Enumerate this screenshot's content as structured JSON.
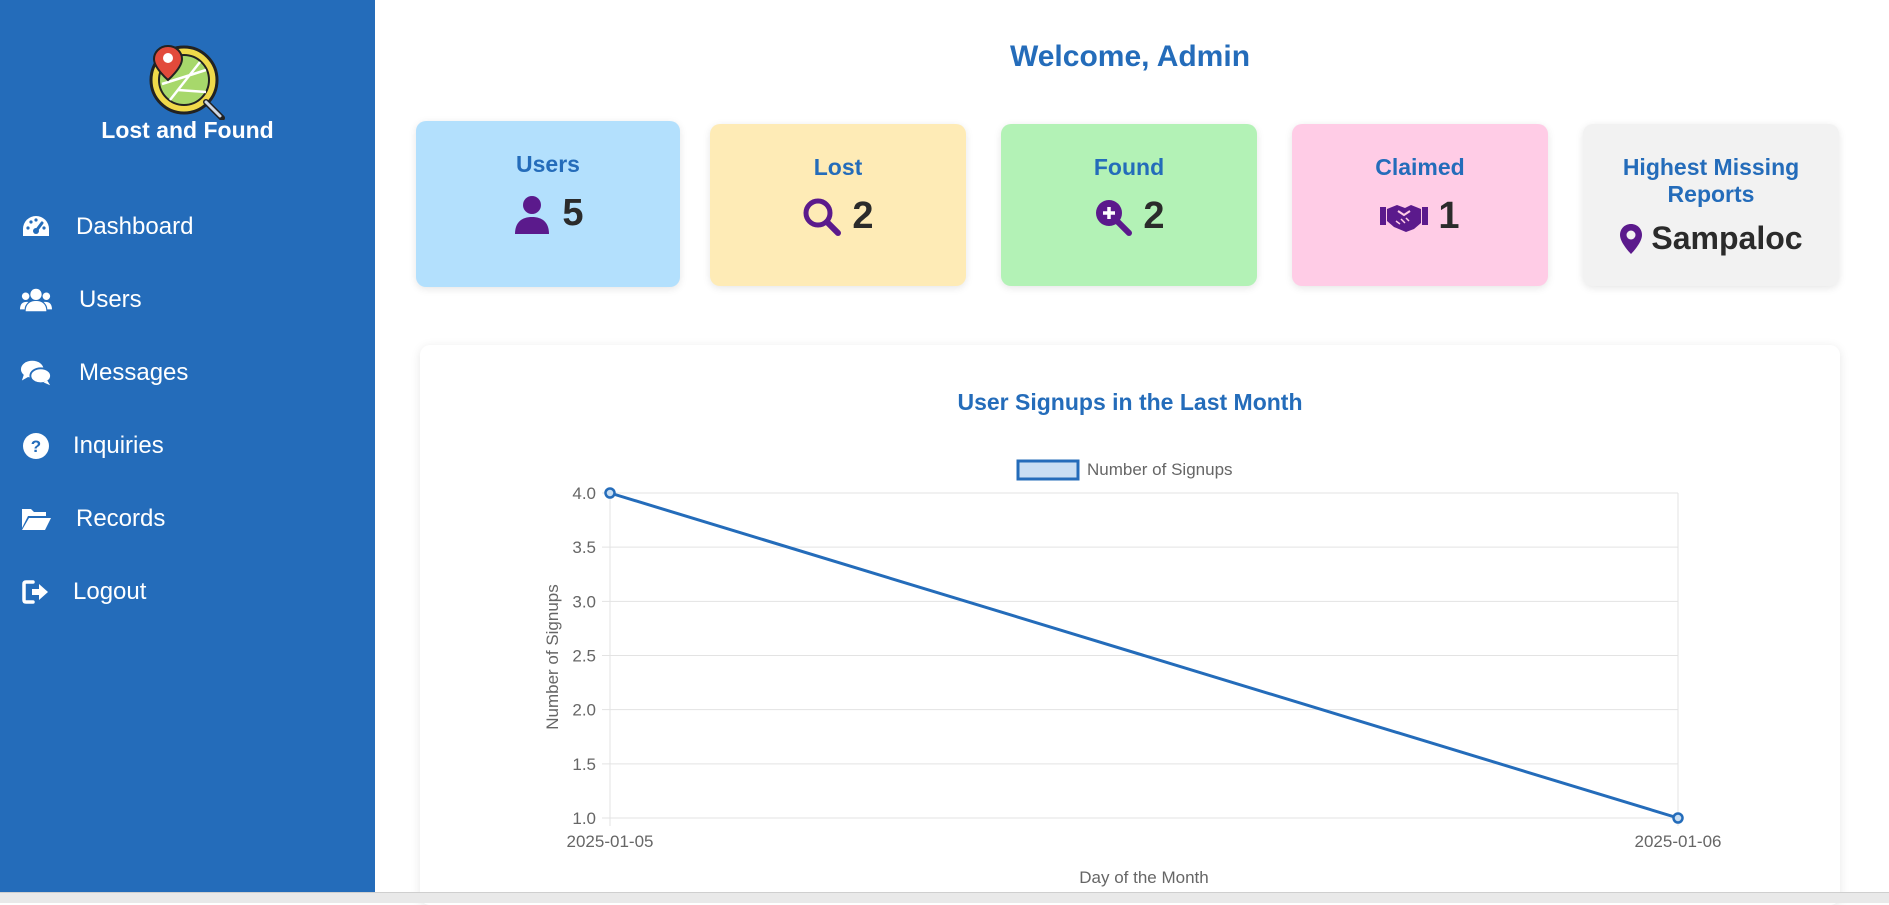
{
  "app": {
    "brand": "Lost and Found",
    "colors": {
      "sidebar": "#246cba",
      "accent": "#246cba",
      "icon_purple": "#5b1a8c"
    }
  },
  "sidebar": {
    "items": [
      {
        "label": "Dashboard",
        "icon": "dashboard-gauge-icon"
      },
      {
        "label": "Users",
        "icon": "users-group-icon"
      },
      {
        "label": "Messages",
        "icon": "chat-bubbles-icon"
      },
      {
        "label": "Inquiries",
        "icon": "question-circle-icon"
      },
      {
        "label": "Records",
        "icon": "folder-open-icon"
      },
      {
        "label": "Logout",
        "icon": "sign-out-icon"
      }
    ]
  },
  "main": {
    "welcome": "Welcome, Admin",
    "cards": [
      {
        "title": "Users",
        "value": "5",
        "icon": "user-icon",
        "color": "#b3e0fd"
      },
      {
        "title": "Lost",
        "value": "2",
        "icon": "search-icon",
        "color": "#feebb6"
      },
      {
        "title": "Found",
        "value": "2",
        "icon": "search-plus-icon",
        "color": "#b3f2b6"
      },
      {
        "title": "Claimed",
        "value": "1",
        "icon": "handshake-icon",
        "color": "#ffcce6"
      },
      {
        "title": "Highest Missing Reports",
        "value": "Sampaloc",
        "icon": "map-pin-icon",
        "color": "#f2f2f2"
      }
    ]
  },
  "chart_data": {
    "type": "line",
    "title": "User Signups in the Last Month",
    "xlabel": "Day of the Month",
    "ylabel": "Number of Signups",
    "categories": [
      "2025-01-05",
      "2025-01-06"
    ],
    "series": [
      {
        "name": "Number of Signups",
        "values": [
          4,
          1
        ],
        "color": "#246cba"
      }
    ],
    "ylim": [
      1.0,
      4.0
    ],
    "yticks": [
      "1.0",
      "1.5",
      "2.0",
      "2.5",
      "3.0",
      "3.5",
      "4.0"
    ],
    "legend": "top",
    "grid": true
  }
}
